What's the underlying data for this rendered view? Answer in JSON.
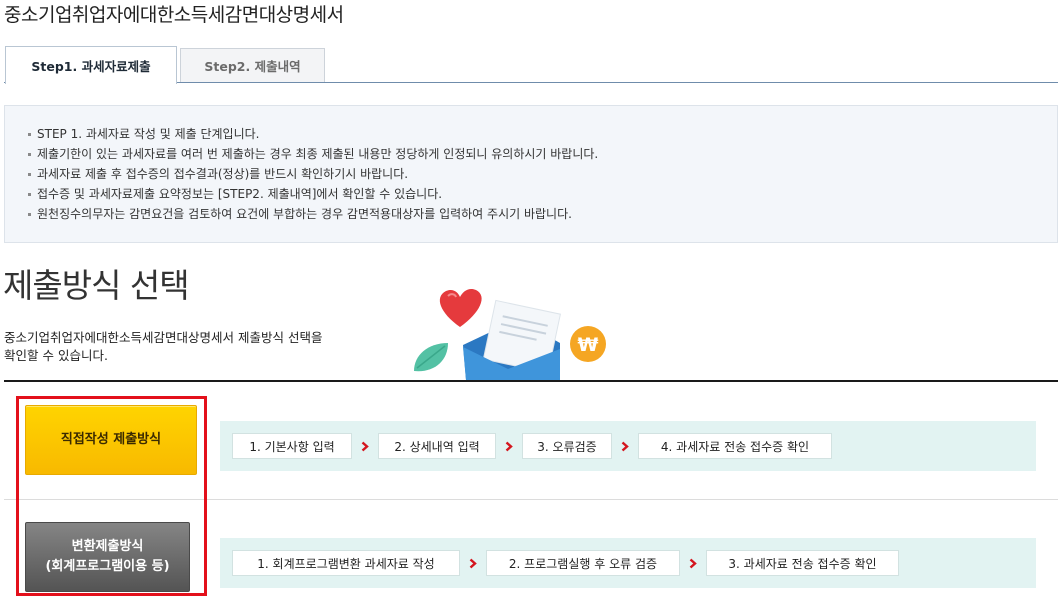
{
  "page": {
    "title": "중소기업취업자에대한소득세감면대상명세서"
  },
  "tabs": [
    {
      "label": "Step1. 과세자료제출",
      "active": true
    },
    {
      "label": "Step2. 제출내역",
      "active": false
    }
  ],
  "notice": {
    "items": [
      "STEP 1. 과세자료 작성 및 제출 단계입니다.",
      "제출기한이 있는 과세자료를 여러 번 제출하는 경우 최종 제출된 내용만 정당하게 인정되니 유의하시기 바랍니다.",
      "과세자료 제출 후 접수증의 접수결과(정상)를 반드시 확인하기시 바랍니다.",
      "접수증 및 과세자료제출 요약정보는 [STEP2. 제출내역]에서 확인할 수 있습니다.",
      "원천징수의무자는 감면요건을 검토하여 요건에 부합하는 경우 감면적용대상자를 입력하여 주시기 바랍니다."
    ]
  },
  "section": {
    "heading": "제출방식 선택",
    "description_lines": [
      "중소기업취업자에대한소득세감면대상명세서 제출방식 선택을",
      "확인할 수 있습니다."
    ],
    "illustration_icons": [
      "heart-icon",
      "envelope-icon",
      "leaf-icon",
      "won-coin-icon"
    ],
    "won_symbol": "₩"
  },
  "methods": [
    {
      "button_lines": [
        "직접작성 제출방식"
      ],
      "steps": [
        "1. 기본사항 입력",
        "2. 상세내역 입력",
        "3. 오류검증",
        "4. 과세자료 전송 접수증 확인"
      ],
      "step_separator_icon": "chevron-right-icon"
    },
    {
      "button_lines": [
        "변환제출방식",
        "(회계프로그램이용 등)"
      ],
      "steps": [
        "1. 회계프로그램변환 과세자료 작성",
        "2. 프로그램실행 후 오류 검증",
        "3. 과세자료 전송 접수증 확인"
      ],
      "step_separator_icon": "chevron-right-icon"
    }
  ],
  "colors": {
    "direct_button": "#ffcc00",
    "convert_button": "#666666",
    "highlight_border": "#e3101b",
    "step_arrow": "#d4161f",
    "steps_background": "#e2f3f2",
    "notice_background": "#f3f6fa"
  }
}
